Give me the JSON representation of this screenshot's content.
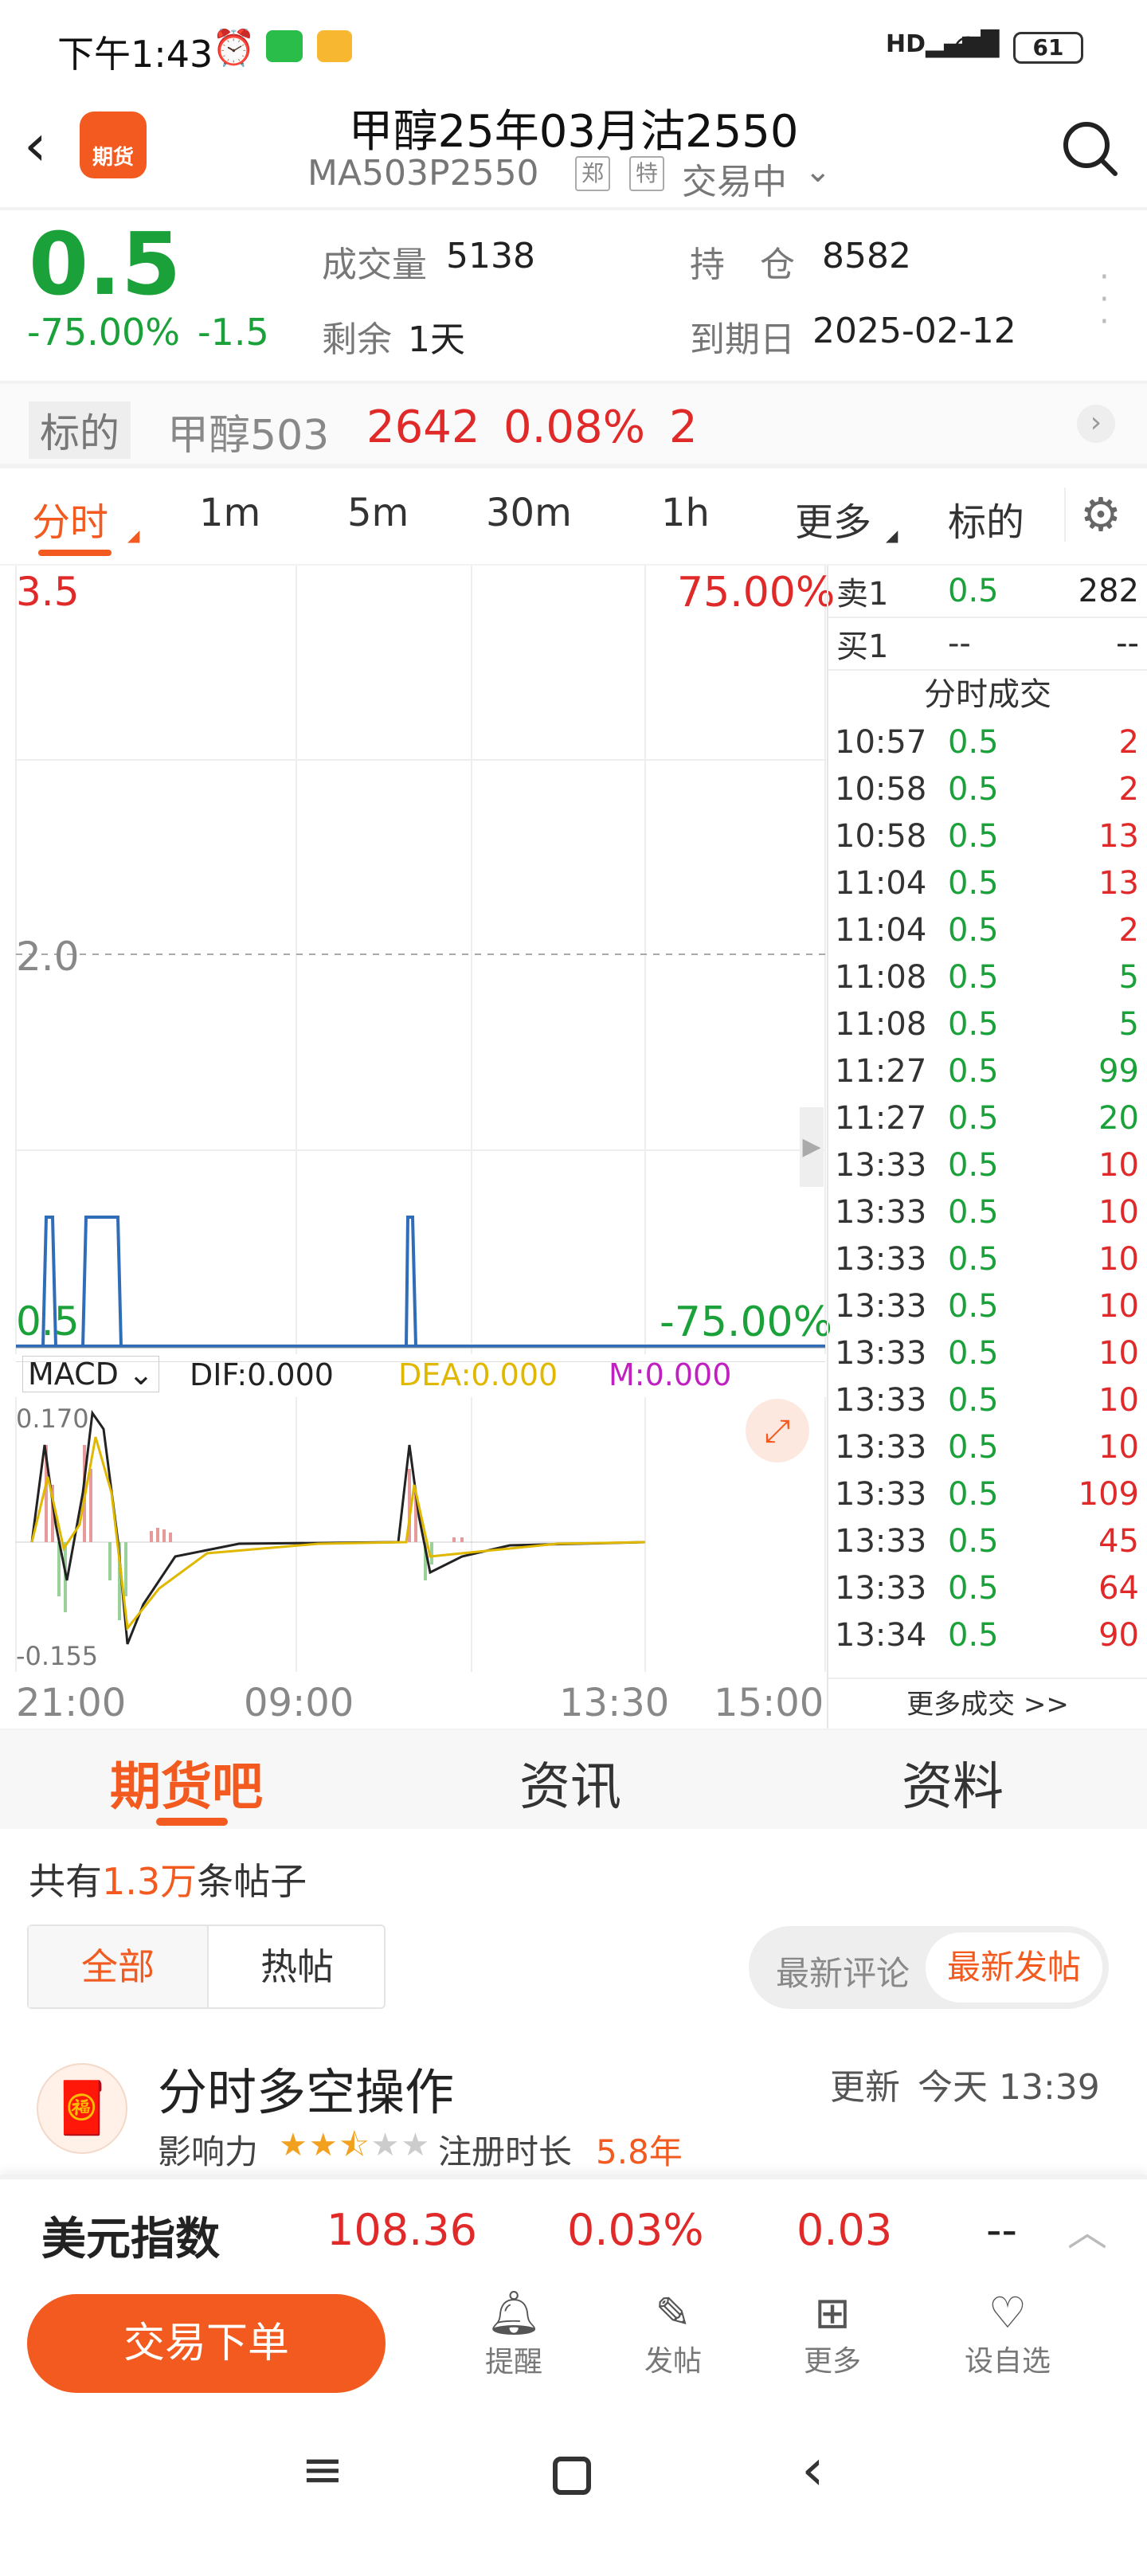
{
  "status_bar": {
    "time": "下午1:43",
    "battery": "61"
  },
  "header": {
    "title": "甲醇25年03月沽2550",
    "code": "MA503P2550",
    "tag1": "郑",
    "tag2": "特",
    "trade_status": "交易中",
    "logo_text": "期货"
  },
  "quote": {
    "price": "0.5",
    "change_pct": "-75.00%",
    "change": "-1.5",
    "volume_label": "成交量",
    "volume": "5138",
    "oi_label": "持　仓",
    "oi": "8582",
    "remain_label": "剩余",
    "remain": "1天",
    "expiry_label": "到期日",
    "expiry": "2025-02-12"
  },
  "underlying": {
    "label": "标的",
    "name": "甲醇503",
    "price": "2642",
    "pct": "0.08%",
    "change": "2"
  },
  "chart_tabs": [
    "分时",
    "1m",
    "5m",
    "30m",
    "1h",
    "更多",
    "标的"
  ],
  "chart": {
    "y_top_left": "3.5",
    "y_top_right": "75.00%",
    "y_mid": "2.0",
    "y_bottom_left": "0.5",
    "y_bottom_right": "-75.00%",
    "x_labels": [
      "21:00",
      "09:00",
      "13:30",
      "15:00"
    ]
  },
  "macd": {
    "selector": "MACD",
    "dif": "DIF:0.000",
    "dea": "DEA:0.000",
    "m": "M:0.000",
    "top": "0.170",
    "bottom": "-0.155"
  },
  "order_book": {
    "sell1_label": "卖1",
    "sell1_price": "0.5",
    "sell1_vol": "282",
    "buy1_label": "买1",
    "buy1_price": "--",
    "buy1_vol": "--",
    "section_title": "分时成交",
    "more_link": "更多成交 >>"
  },
  "trades": [
    {
      "time": "10:57",
      "price": "0.5",
      "vol": "2",
      "color": "#e02929"
    },
    {
      "time": "10:58",
      "price": "0.5",
      "vol": "2",
      "color": "#e02929"
    },
    {
      "time": "10:58",
      "price": "0.5",
      "vol": "13",
      "color": "#e02929"
    },
    {
      "time": "11:04",
      "price": "0.5",
      "vol": "13",
      "color": "#e02929"
    },
    {
      "time": "11:04",
      "price": "0.5",
      "vol": "2",
      "color": "#e02929"
    },
    {
      "time": "11:08",
      "price": "0.5",
      "vol": "5",
      "color": "#1ba13a"
    },
    {
      "time": "11:08",
      "price": "0.5",
      "vol": "5",
      "color": "#1ba13a"
    },
    {
      "time": "11:27",
      "price": "0.5",
      "vol": "99",
      "color": "#1ba13a"
    },
    {
      "time": "11:27",
      "price": "0.5",
      "vol": "20",
      "color": "#1ba13a"
    },
    {
      "time": "13:33",
      "price": "0.5",
      "vol": "10",
      "color": "#e02929"
    },
    {
      "time": "13:33",
      "price": "0.5",
      "vol": "10",
      "color": "#e02929"
    },
    {
      "time": "13:33",
      "price": "0.5",
      "vol": "10",
      "color": "#e02929"
    },
    {
      "time": "13:33",
      "price": "0.5",
      "vol": "10",
      "color": "#e02929"
    },
    {
      "time": "13:33",
      "price": "0.5",
      "vol": "10",
      "color": "#e02929"
    },
    {
      "time": "13:33",
      "price": "0.5",
      "vol": "10",
      "color": "#e02929"
    },
    {
      "time": "13:33",
      "price": "0.5",
      "vol": "10",
      "color": "#e02929"
    },
    {
      "time": "13:33",
      "price": "0.5",
      "vol": "109",
      "color": "#e02929"
    },
    {
      "time": "13:33",
      "price": "0.5",
      "vol": "45",
      "color": "#e02929"
    },
    {
      "time": "13:33",
      "price": "0.5",
      "vol": "64",
      "color": "#e02929"
    },
    {
      "time": "13:34",
      "price": "0.5",
      "vol": "90",
      "color": "#e02929"
    }
  ],
  "content_tabs": [
    "期货吧",
    "资讯",
    "资料"
  ],
  "posts": {
    "count_prefix": "共有",
    "count_value": "1.3万",
    "count_suffix": "条帖子",
    "filter_all": "全部",
    "filter_hot": "热帖",
    "sort_comment": "最新评论",
    "sort_post": "最新发帖",
    "first_post": {
      "title": "分时多空操作",
      "updated_label": "更新",
      "updated_time": "今天 13:39",
      "influence_label": "影响力",
      "reg_label": "注册时长",
      "reg_value": "5.8年",
      "stars": 2.5
    }
  },
  "ticker": {
    "name": "美元指数",
    "price": "108.36",
    "pct": "0.03%",
    "change": "0.03",
    "extra": "--"
  },
  "bottom_bar": {
    "trade_button": "交易下单",
    "remind": "提醒",
    "post": "发帖",
    "more": "更多",
    "watch": "设自选"
  },
  "colors": {
    "accent": "#f25a1f",
    "up": "#e02929",
    "down": "#1ba13a",
    "line": "#2f6db8",
    "dea": "#e0b800",
    "m": "#c020c0"
  }
}
